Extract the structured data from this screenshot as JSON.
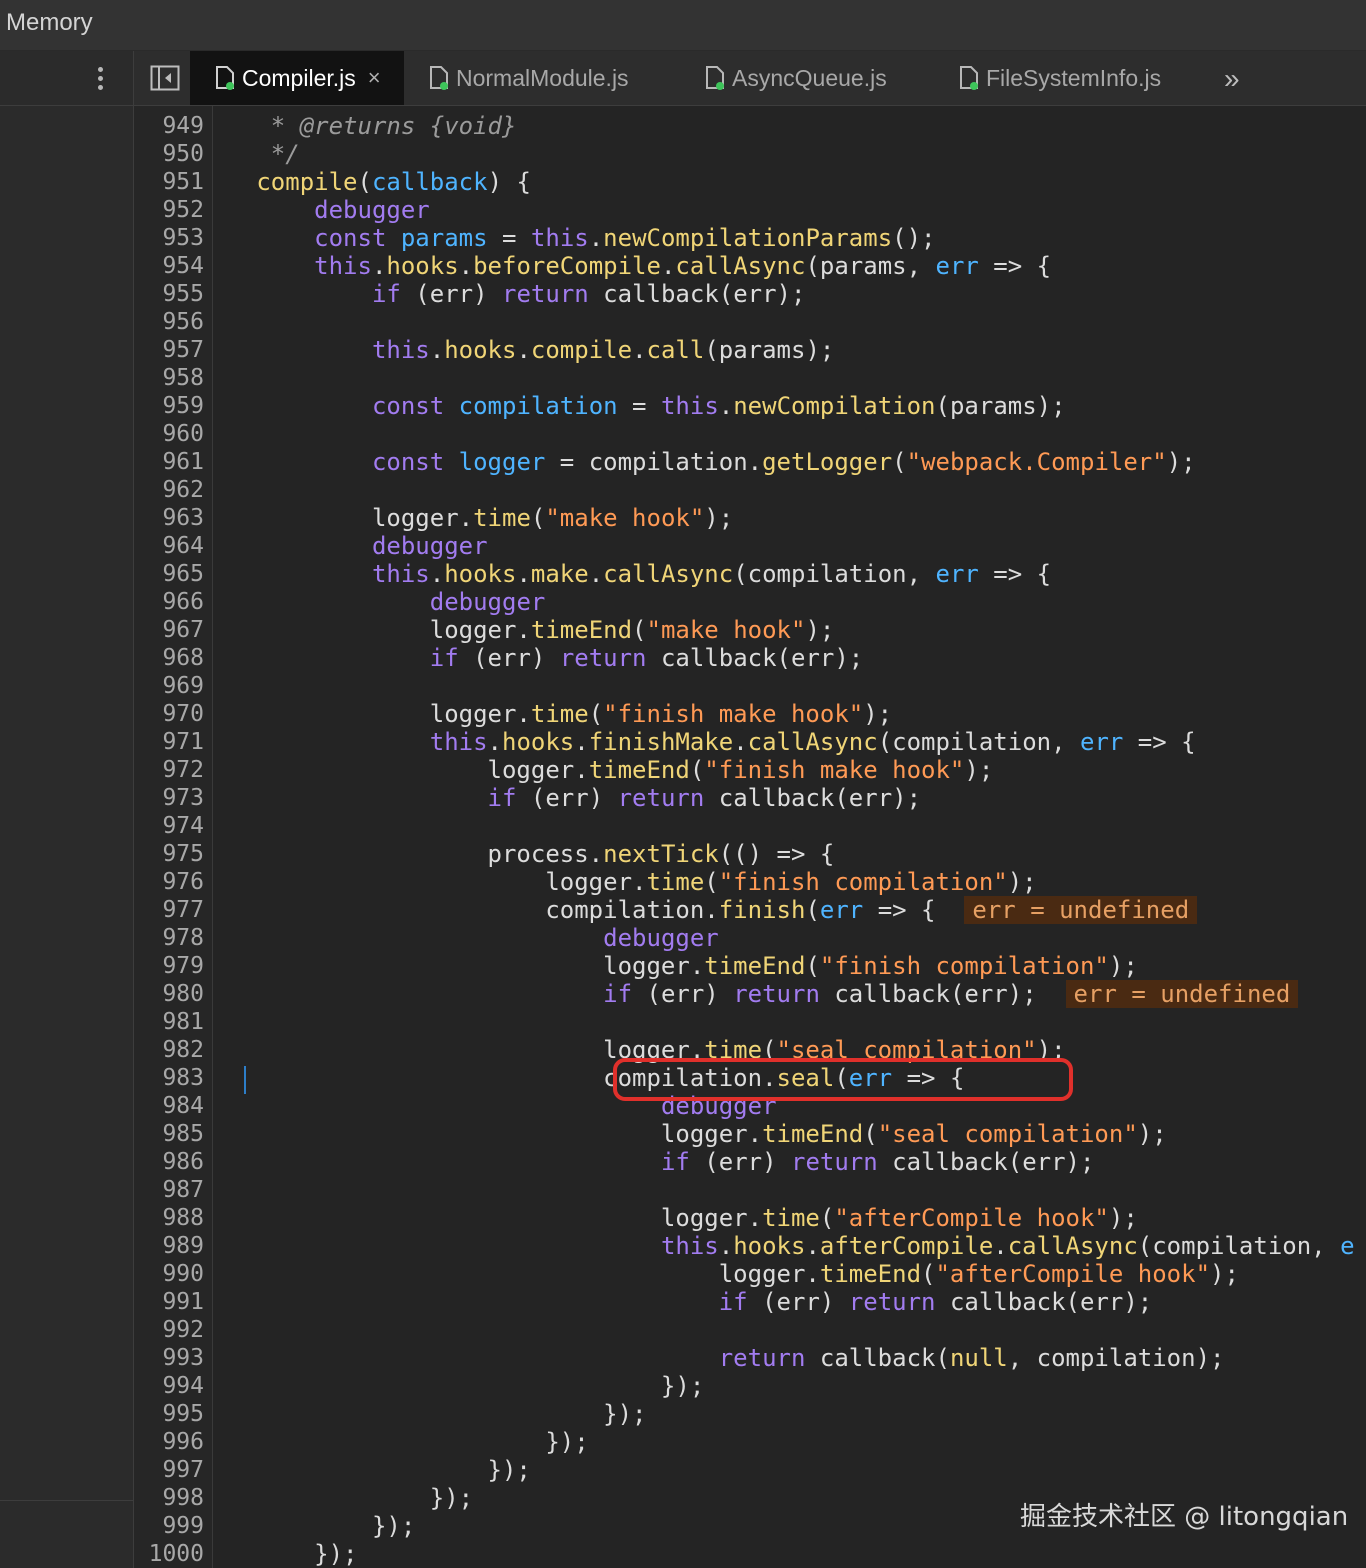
{
  "top_panel": {
    "tab_label": "Memory"
  },
  "tabs": [
    {
      "label": "Compiler.js",
      "active": true,
      "close": "×"
    },
    {
      "label": "NormalModule.js",
      "active": false
    },
    {
      "label": "AsyncQueue.js",
      "active": false
    },
    {
      "label": "FileSystemInfo.js",
      "active": false
    }
  ],
  "more_tabs": "»",
  "code": {
    "lines": [
      {
        "n": "949",
        "html": "    <span class='c'>* @returns {void}</span>"
      },
      {
        "n": "950",
        "html": "    <span class='c'>*/</span>"
      },
      {
        "n": "951",
        "html": "   <span class='f'>compile</span>(<span class='v'>callback</span>) {"
      },
      {
        "n": "952",
        "html": "       <span class='k'>debugger</span>"
      },
      {
        "n": "953",
        "html": "       <span class='k'>const</span> <span class='v'>params</span> = <span class='t'>this</span>.<span class='f'>newCompilationParams</span>();"
      },
      {
        "n": "954",
        "html": "       <span class='t'>this</span>.<span class='f'>hooks</span>.<span class='f'>beforeCompile</span>.<span class='f'>callAsync</span>(params, <span class='v'>err</span> =&gt; {"
      },
      {
        "n": "955",
        "html": "           <span class='k'>if</span> (err) <span class='k'>return</span> callback(err);"
      },
      {
        "n": "956",
        "html": ""
      },
      {
        "n": "957",
        "html": "           <span class='t'>this</span>.<span class='f'>hooks</span>.<span class='f'>compile</span>.<span class='f'>call</span>(params);"
      },
      {
        "n": "958",
        "html": ""
      },
      {
        "n": "959",
        "html": "           <span class='k'>const</span> <span class='v'>compilation</span> = <span class='t'>this</span>.<span class='f'>newCompilation</span>(params);"
      },
      {
        "n": "960",
        "html": ""
      },
      {
        "n": "961",
        "html": "           <span class='k'>const</span> <span class='v'>logger</span> = compilation.<span class='f'>getLogger</span>(<span class='s'>\"webpack.Compiler\"</span>);"
      },
      {
        "n": "962",
        "html": ""
      },
      {
        "n": "963",
        "html": "           logger.<span class='f'>time</span>(<span class='s'>\"make hook\"</span>);"
      },
      {
        "n": "964",
        "html": "           <span class='k'>debugger</span>"
      },
      {
        "n": "965",
        "html": "           <span class='t'>this</span>.<span class='f'>hooks</span>.<span class='f'>make</span>.<span class='f'>callAsync</span>(compilation, <span class='v'>err</span> =&gt; {"
      },
      {
        "n": "966",
        "html": "               <span class='k'>debugger</span>"
      },
      {
        "n": "967",
        "html": "               logger.<span class='f'>timeEnd</span>(<span class='s'>\"make hook\"</span>);"
      },
      {
        "n": "968",
        "html": "               <span class='k'>if</span> (err) <span class='k'>return</span> callback(err);"
      },
      {
        "n": "969",
        "html": ""
      },
      {
        "n": "970",
        "html": "               logger.<span class='f'>time</span>(<span class='s'>\"finish make hook\"</span>);"
      },
      {
        "n": "971",
        "html": "               <span class='t'>this</span>.<span class='f'>hooks</span>.<span class='f'>finishMake</span>.<span class='f'>callAsync</span>(compilation, <span class='v'>err</span> =&gt; {"
      },
      {
        "n": "972",
        "html": "                   logger.<span class='f'>timeEnd</span>(<span class='s'>\"finish make hook\"</span>);"
      },
      {
        "n": "973",
        "html": "                   <span class='k'>if</span> (err) <span class='k'>return</span> callback(err);"
      },
      {
        "n": "974",
        "html": ""
      },
      {
        "n": "975",
        "html": "                   process.<span class='f'>nextTick</span>(() =&gt; {"
      },
      {
        "n": "976",
        "html": "                       logger.<span class='f'>time</span>(<span class='s'>\"finish compilation\"</span>);"
      },
      {
        "n": "977",
        "html": "                       compilation.<span class='f'>finish</span>(<span class='v'>err</span> =&gt; {  <span class='inline-value'>err = undefined</span>"
      },
      {
        "n": "978",
        "html": "                           <span class='k'>debugger</span>"
      },
      {
        "n": "979",
        "html": "                           logger.<span class='f'>timeEnd</span>(<span class='s'>\"finish compilation\"</span>);"
      },
      {
        "n": "980",
        "html": "                           <span class='k'>if</span> (err) <span class='k'>return</span> callback(err);  <span class='inline-value'>err = undefined</span>"
      },
      {
        "n": "981",
        "html": ""
      },
      {
        "n": "982",
        "html": "                           logger.<span class='f'>time</span>(<span class='s'>\"seal compilation\"</span>);"
      },
      {
        "n": "983",
        "html": "                           compilation.<span class='f'>seal</span>(<span class='v'>err</span> =&gt; {"
      },
      {
        "n": "984",
        "html": "                               <span class='k'>debugger</span>"
      },
      {
        "n": "985",
        "html": "                               logger.<span class='f'>timeEnd</span>(<span class='s'>\"seal compilation\"</span>);"
      },
      {
        "n": "986",
        "html": "                               <span class='k'>if</span> (err) <span class='k'>return</span> callback(err);"
      },
      {
        "n": "987",
        "html": ""
      },
      {
        "n": "988",
        "html": "                               logger.<span class='f'>time</span>(<span class='s'>\"afterCompile hook\"</span>);"
      },
      {
        "n": "989",
        "html": "                               <span class='t'>this</span>.<span class='f'>hooks</span>.<span class='f'>afterCompile</span>.<span class='f'>callAsync</span>(compilation, <span class='v'>e</span>"
      },
      {
        "n": "990",
        "html": "                                   logger.<span class='f'>timeEnd</span>(<span class='s'>\"afterCompile hook\"</span>);"
      },
      {
        "n": "991",
        "html": "                                   <span class='k'>if</span> (err) <span class='k'>return</span> callback(err);"
      },
      {
        "n": "992",
        "html": ""
      },
      {
        "n": "993",
        "html": "                                   <span class='k'>return</span> callback(<span class='f'>null</span>, compilation);"
      },
      {
        "n": "994",
        "html": "                               });"
      },
      {
        "n": "995",
        "html": "                           });"
      },
      {
        "n": "996",
        "html": "                       });"
      },
      {
        "n": "997",
        "html": "                   });"
      },
      {
        "n": "998",
        "html": "               });"
      },
      {
        "n": "999",
        "html": "           });"
      },
      {
        "n": "1000",
        "html": "       });"
      }
    ]
  },
  "watermark": "掘金技术社区 @ litongqian"
}
